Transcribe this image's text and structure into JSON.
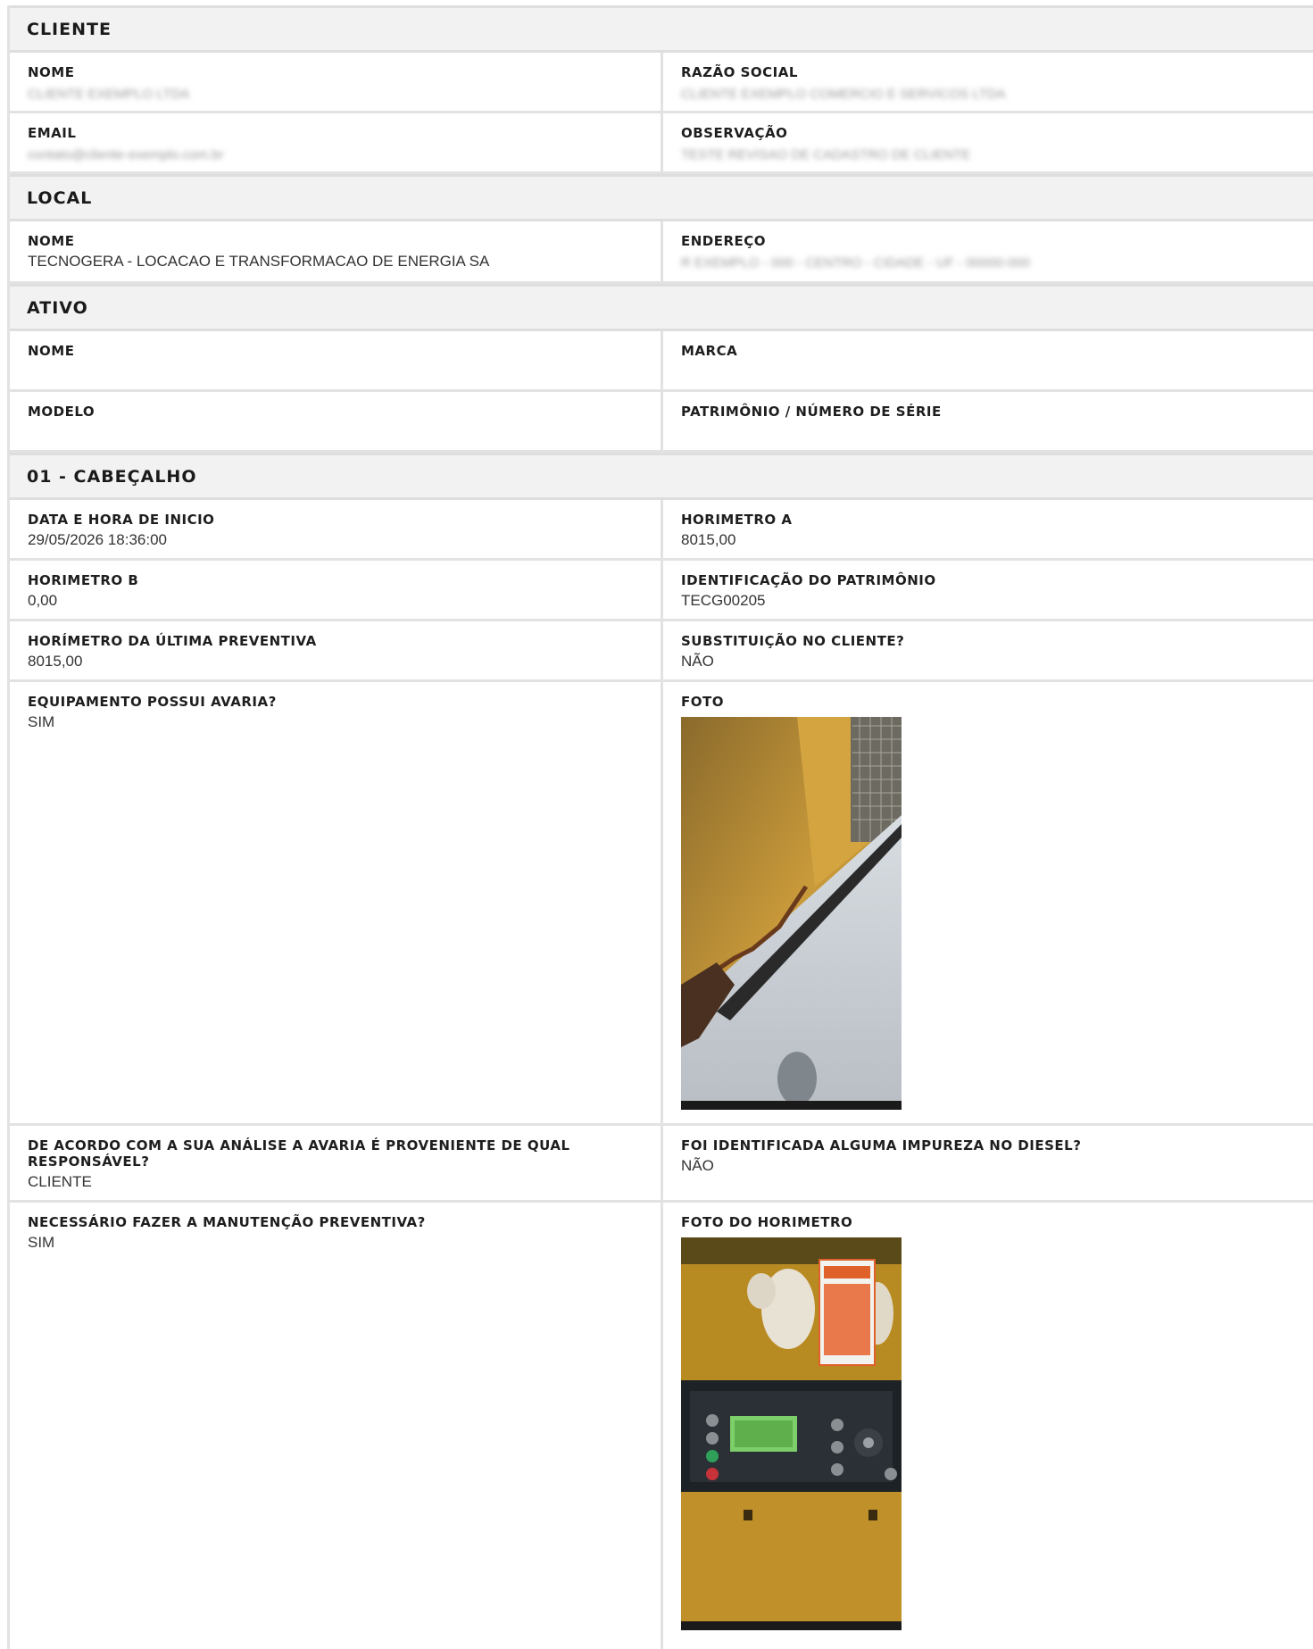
{
  "sections": {
    "cliente": "CLIENTE",
    "local": "LOCAL",
    "ativo": "ATIVO",
    "cabecalho": "01 - CABEÇALHO"
  },
  "cliente": {
    "nome_label": "NOME",
    "nome_value": "CLIENTE EXEMPLO LTDA",
    "razao_label": "RAZÃO SOCIAL",
    "razao_value": "CLIENTE EXEMPLO COMERCIO E SERVICOS LTDA",
    "email_label": "EMAIL",
    "email_value": "contato@cliente-exemplo.com.br",
    "obs_label": "OBSERVAÇÃO",
    "obs_value": "TESTE REVISAO DE CADASTRO DE CLIENTE"
  },
  "local": {
    "nome_label": "NOME",
    "nome_value": "TECNOGERA - LOCACAO E TRANSFORMACAO DE ENERGIA SA",
    "endereco_label": "ENDEREÇO",
    "endereco_value": "R EXEMPLO - 000 - CENTRO - CIDADE - UF - 00000-000"
  },
  "ativo": {
    "nome_label": "NOME",
    "marca_label": "MARCA",
    "modelo_label": "MODELO",
    "patrimonio_label": "PATRIMÔNIO / NÚMERO DE SÉRIE"
  },
  "cabecalho": {
    "data_label": "DATA E HORA DE INICIO",
    "data_value": "29/05/2026 18:36:00",
    "horimetro_a_label": "HORIMETRO A",
    "horimetro_a_value": "8015,00",
    "horimetro_b_label": "HORIMETRO B",
    "horimetro_b_value": "0,00",
    "ident_label": "IDENTIFICAÇÃO DO PATRIMÔNIO",
    "ident_value": "TECG00205",
    "ultima_label": "HORÍMETRO DA ÚLTIMA PREVENTIVA",
    "ultima_value": "8015,00",
    "subst_label": "SUBSTITUIÇÃO NO CLIENTE?",
    "subst_value": "NÃO",
    "avaria_label": "EQUIPAMENTO POSSUI AVARIA?",
    "avaria_value": "SIM",
    "foto_label": "FOTO",
    "responsavel_label": "DE ACORDO COM A SUA ANÁLISE A AVARIA É PROVENIENTE DE QUAL RESPONSÁVEL?",
    "responsavel_value": "CLIENTE",
    "impureza_label": "FOI IDENTIFICADA ALGUMA IMPUREZA NO DIESEL?",
    "impureza_value": "NÃO",
    "preventiva_label": "NECESSÁRIO FAZER A MANUTENÇÃO PREVENTIVA?",
    "preventiva_value": "SIM",
    "foto_horimetro_label": "FOTO DO HORIMETRO"
  }
}
